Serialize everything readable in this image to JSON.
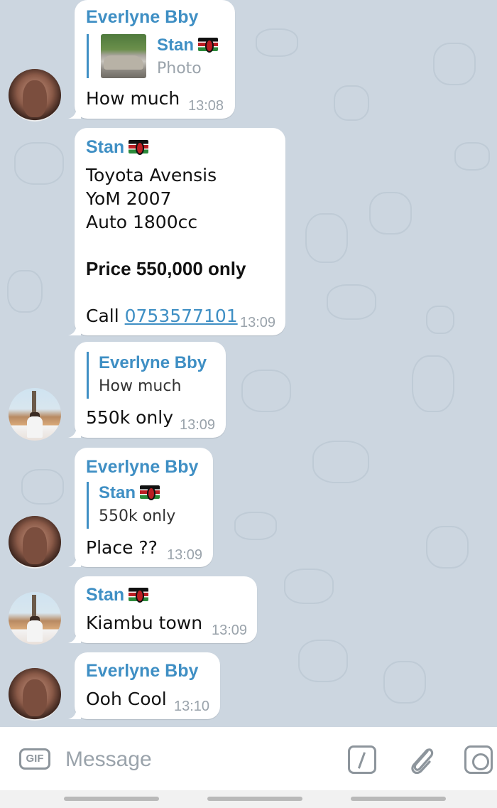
{
  "messages": [
    {
      "sender": "Everlyne Bby",
      "reply_to": {
        "name": "Stan",
        "text": "Photo"
      },
      "text": "How much",
      "time": "13:08"
    },
    {
      "sender": "Stan",
      "lines": [
        "Toyota Avensis",
        "YoM 2007",
        "Auto 1800cc"
      ],
      "price_line": "Price 550,000 only",
      "call_label": "Call",
      "phone": "0753577101",
      "time": "13:09"
    },
    {
      "reply_to": {
        "name": "Everlyne Bby",
        "text": "How much"
      },
      "text": "550k only",
      "time": "13:09"
    },
    {
      "sender": "Everlyne Bby",
      "reply_to": {
        "name": "Stan",
        "text": "550k only"
      },
      "text": "Place ??",
      "time": "13:09"
    },
    {
      "sender": "Stan",
      "text": "Kiambu town",
      "time": "13:09"
    },
    {
      "sender": "Everlyne Bby",
      "text": "Ooh Cool",
      "time": "13:10"
    }
  ],
  "input": {
    "gif_label": "GIF",
    "placeholder": "Message"
  },
  "icons": {
    "gif": "gif-icon",
    "command": "slash-command-icon",
    "attach": "paperclip-icon",
    "camera": "camera-icon",
    "flag": "kenya-flag-icon"
  },
  "colors": {
    "background": "#ccd6e0",
    "bubble": "#ffffff",
    "accent": "#3f8fc4",
    "time": "#9aa3ab"
  }
}
